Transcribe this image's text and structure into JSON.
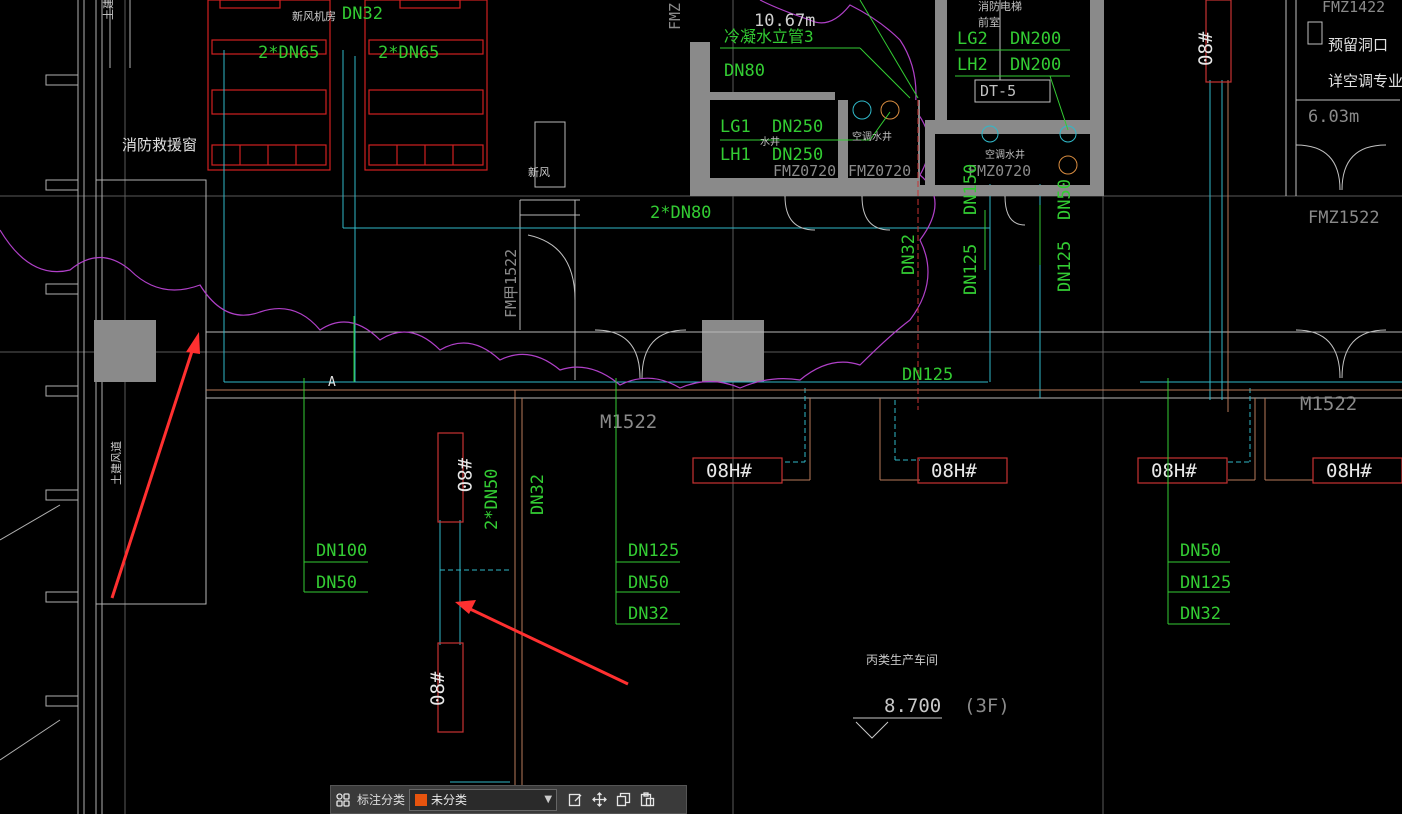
{
  "colors": {
    "background": "#000000",
    "wall": "#8a8a8a",
    "label": "#33cc33",
    "pipe_cyan": "#30b8c8",
    "pipe_red": "#c83232",
    "annot_white": "#d8d8d8",
    "cloud": "#b040c8",
    "arrow": "#ff3030"
  },
  "labels": {
    "fire_window": "消防救援窗",
    "fresh_air_room": "新风机房",
    "fresh_air": "新风",
    "dn32_top": "DN32",
    "dn65_a": "2*DN65",
    "dn65_b": "2*DN65",
    "riser": "冷凝水立管3",
    "dn80_top": "DN80",
    "area_top": "10.67m",
    "lg1": "LG1",
    "lh1": "LH1",
    "dn250_a": "DN250",
    "dn250_b": "DN250",
    "water_well": "水井",
    "ac_well_1": "空调水井",
    "ac_well_2": "空调水井",
    "fire_elev_1": "消防电梯",
    "fire_elev_2": "前室",
    "lg2": "LG2",
    "lh2": "LH2",
    "dn200_a": "DN200",
    "dn200_b": "DN200",
    "dt5": "DT-5",
    "dn150": "DN150",
    "dn50_v": "DN50",
    "dn125_v1": "DN125",
    "dn125_v2": "DN125",
    "dn32_v": "DN32",
    "fmz0720_a": "FMZ0720",
    "fmz0720_b": "FMZ0720",
    "fmz0720_c": "FMZ0720",
    "dn80_2": "2*DN80",
    "fm1522": "FM甲1522",
    "fmz1422": "FMZ1422",
    "reserve": "预留洞口",
    "ac_spec": "详空调专业",
    "area_right": "6.03m",
    "fmz1522": "FMZ1522",
    "axis_a": "A",
    "dn125_mid": "DN125",
    "m1522_a": "M1522",
    "m1522_b": "M1522",
    "h08_1": "08H#",
    "h08_2": "08H#",
    "h08_3": "08H#",
    "h08_4": "08H#",
    "v80_top": "#80",
    "v08_bottom": "08#",
    "v08_right": "08#",
    "dn50_2": "2*DN50",
    "dn32_mid": "DN32",
    "dn100": "DN100",
    "dn50_a": "DN50",
    "dn125_b": "DN125",
    "dn50_b": "DN50",
    "dn32_b": "DN32",
    "dn50_c": "DN50",
    "dn125_c": "DN125",
    "dn32_c": "DN32",
    "workshop": "丙类生产车间",
    "elevation": "8.700",
    "floor": "(3F)",
    "air_duct_1": "土建风道",
    "air_duct_2": "土建风道",
    "fmz_top": "FMZ"
  },
  "toolbar": {
    "label": "标注分类",
    "select_value": "未分类",
    "select_color": "#e8540e",
    "icons": [
      "grid-icon",
      "edit-icon",
      "move-icon",
      "copy-icon",
      "paste-icon"
    ]
  }
}
